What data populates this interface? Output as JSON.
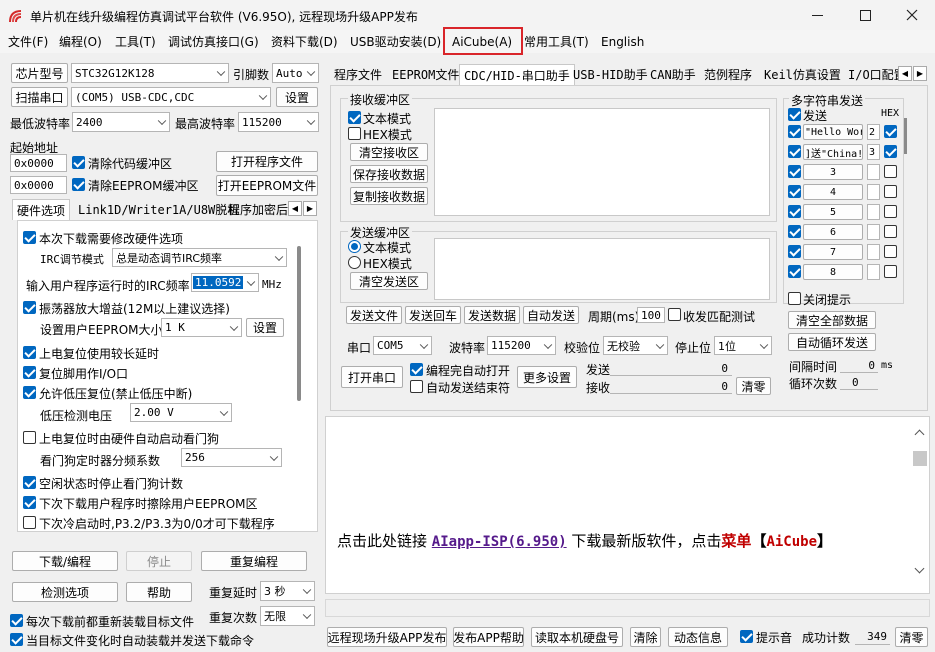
{
  "window": {
    "title": "单片机在线升级编程仿真调试平台软件 (V6.95O), 远程现场升级APP发布"
  },
  "menu": [
    "文件(F)",
    "编程(O)",
    "工具(T)",
    "调试仿真接口(G)",
    "资料下载(D)",
    "USB驱动安装(D)",
    "AiCube(A)",
    "常用工具(T)",
    "English"
  ],
  "left": {
    "chip_btn": "芯片型号",
    "chip_value": "STC32G12K128",
    "pin_label": "引脚数",
    "pin_value": "Auto",
    "scan_btn": "扫描串口",
    "port_value": "(COM5) USB-CDC,CDC",
    "settings_btn": "设置",
    "min_baud_label": "最低波特率",
    "min_baud": "2400",
    "max_baud_label": "最高波特率",
    "max_baud": "115200",
    "start_addr_label": "起始地址",
    "addr1": "0x0000",
    "clear_code": "清除代码缓冲区",
    "open_prog": "打开程序文件",
    "addr2": "0x0000",
    "clear_eeprom": "清除EEPROM缓冲区",
    "open_eeprom": "打开EEPROM文件",
    "tabs": [
      "硬件选项",
      "Link1D/Writer1A/U8W脱机",
      "程序加密后"
    ],
    "hw": {
      "opt1": "本次下载需要修改硬件选项",
      "irc_mode_label": "IRC调节模式",
      "irc_mode_value": "总是动态调节IRC频率",
      "irc_freq_label": "输入用户程序运行时的IRC频率",
      "irc_freq_value": "11.0592",
      "irc_unit": "MHz",
      "opt2": "振荡器放大增益(12M以上建议选择)",
      "eeprom_size_label": "设置用户EEPROM大小",
      "eeprom_size_value": "1   K",
      "eeprom_set_btn": "设置",
      "opt3": "上电复位使用较长延时",
      "opt4": "复位脚用作I/O口",
      "opt5": "允许低压复位(禁止低压中断)",
      "lv_label": "低压检测电压",
      "lv_value": "2.00 V",
      "opt6": "上电复位时由硬件自动启动看门狗",
      "wdt_label": "看门狗定时器分频系数",
      "wdt_value": "256",
      "opt7": "空闲状态时停止看门狗计数",
      "opt8": "下次下载用户程序时擦除用户EEPROM区",
      "opt9": "下次冷启动时,P3.2/P3.3为0/0才可下载程序"
    },
    "download_btn": "下载/编程",
    "stop_btn": "停止",
    "reprog_btn": "重复编程",
    "check_btn": "检测选项",
    "help_btn": "帮助",
    "repeat_delay_label": "重复延时",
    "repeat_delay_value": "3 秒",
    "repeat_count_label": "重复次数",
    "repeat_count_value": "无限",
    "reload_label": "每次下载前都重新装载目标文件",
    "auto_label": "当目标文件变化时自动装载并发送下载命令"
  },
  "right": {
    "tabs": [
      "程序文件",
      "EEPROM文件",
      "CDC/HID-串口助手",
      "USB-HID助手",
      "CAN助手",
      "范例程序",
      "Keil仿真设置",
      "I/O口配置"
    ],
    "recv": {
      "title": "接收缓冲区",
      "text_mode": "文本模式",
      "hex_mode": "HEX模式",
      "clear": "清空接收区",
      "save": "保存接收数据",
      "copy": "复制接收数据"
    },
    "send": {
      "title": "发送缓冲区",
      "text_mode": "文本模式",
      "hex_mode": "HEX模式",
      "clear": "清空发送区"
    },
    "multi": {
      "title": "多字符串发送",
      "send_col": "发送",
      "hex_col": "HEX",
      "rows": [
        {
          "label": "\"Hello Wor",
          "num": "2"
        },
        {
          "label": "]送\"China!",
          "num": "3"
        },
        {
          "label": "3",
          "num": ""
        },
        {
          "label": "4",
          "num": ""
        },
        {
          "label": "5",
          "num": ""
        },
        {
          "label": "6",
          "num": ""
        },
        {
          "label": "7",
          "num": ""
        },
        {
          "label": "8",
          "num": ""
        }
      ],
      "close_hint": "关闭提示",
      "clear_all": "清空全部数据",
      "auto_loop": "自动循环发送",
      "interval_label": "间隔时间",
      "interval_value": "0",
      "interval_unit": "ms",
      "loop_label": "循环次数",
      "loop_value": "0"
    },
    "actions": {
      "send_file": "发送文件",
      "send_return": "发送回车",
      "send_data": "发送数据",
      "auto_send": "自动发送",
      "period_label": "周期(ms)",
      "period_value": "100",
      "match_label": "收发匹配测试"
    },
    "port": {
      "port_label": "串口",
      "port_value": "COM5",
      "baud_label": "波特率",
      "baud_value": "115200",
      "parity_label": "校验位",
      "parity_value": "无校验",
      "stop_label": "停止位",
      "stop_value": "1位",
      "open_btn": "打开串口",
      "auto_open": "编程完自动打开",
      "auto_end": "自动发送结束符",
      "more_btn": "更多设置",
      "send_label": "发送",
      "send_count": "0",
      "recv_label": "接收",
      "recv_count": "0",
      "clear_btn": "清零"
    },
    "log": {
      "prefix": "点击此处链接 ",
      "link": "AIapp-ISP(6.950)",
      "mid": " 下载最新版软件，点击",
      "menu_word": "菜单",
      "bracket_open": "【",
      "brand": "AiCube",
      "bracket_close": "】"
    }
  },
  "bottom": {
    "publish": "远程现场升级APP发布",
    "publish_help": "发布APP帮助",
    "read_disk": "读取本机硬盘号",
    "clear": "清除",
    "dynamic": "动态信息",
    "sound": "提示音",
    "success_label": "成功计数",
    "success_value": "349",
    "clear2": "清零"
  },
  "colors": {
    "accent": "#0067c0",
    "highlight_box": "#d9252a",
    "link": "#551a8b",
    "red_text": "#c00000"
  }
}
